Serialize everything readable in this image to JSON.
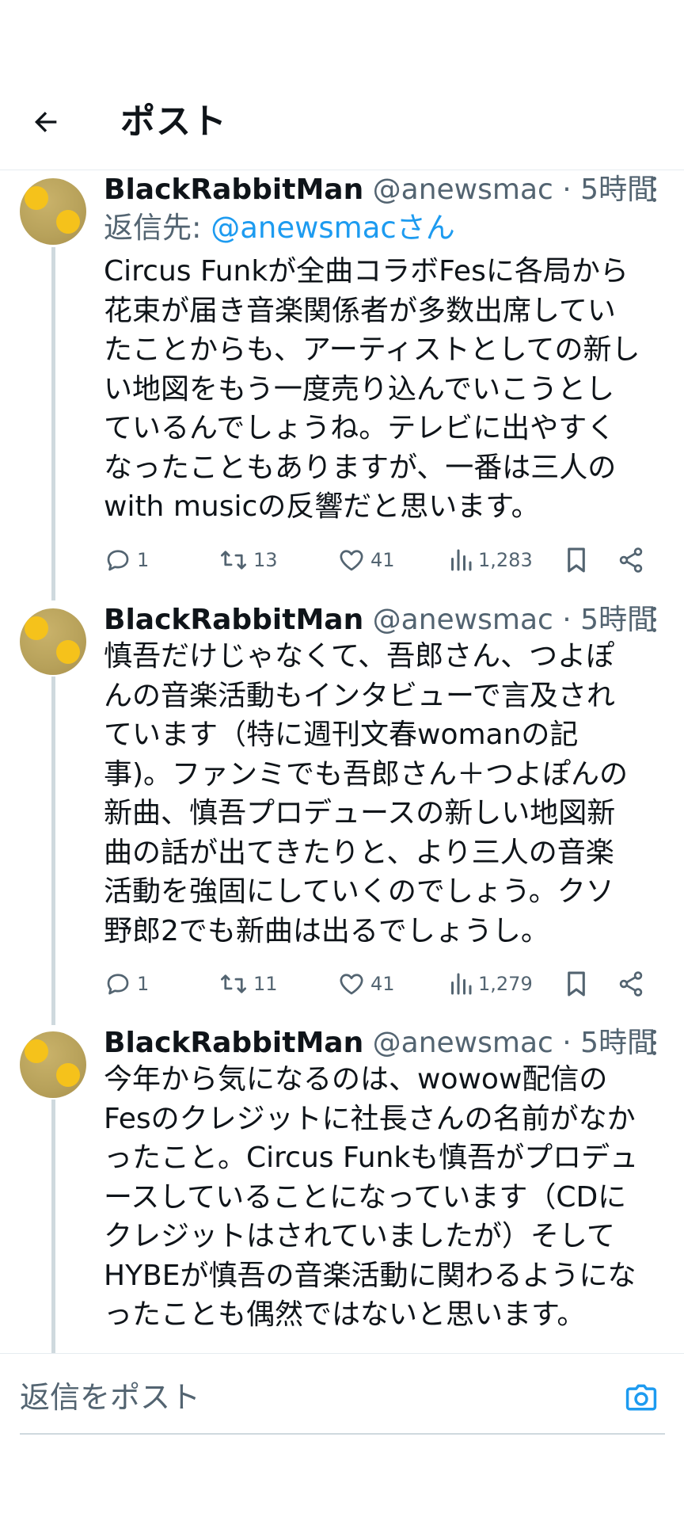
{
  "header": {
    "title": "ポスト"
  },
  "posts": [
    {
      "author": "BlackRabbitMan",
      "handle": "@anewsmac",
      "separator": "·",
      "time": "5時間",
      "reply_label": "返信先:",
      "reply_mention": "@anewsmacさん",
      "text_lines": [
        "Circus Funkが全曲コラボFesに各局から",
        "花束が届き音楽関係者が多数出席してい",
        "たことからも、アーティストとしての新し",
        "い地図をもう一度売り込んでいこうとし",
        "ているんでしょうね。テレビに出やすく",
        "なったこともありますが、一番は三人の",
        "with musicの反響だと思います。"
      ],
      "stats": {
        "replies": "1",
        "reposts": "13",
        "likes": "41",
        "views": "1,283"
      }
    },
    {
      "author": "BlackRabbitMan",
      "handle": "@anewsmac",
      "separator": "·",
      "time": "5時間",
      "text_lines": [
        "慎吾だけじゃなくて、吾郎さん、つよぽ",
        "んの音楽活動もインタビューで言及され",
        "ています（特に週刊文春womanの記",
        "事)。ファンミでも吾郎さん＋つよぽんの",
        "新曲、慎吾プロデュースの新しい地図新",
        "曲の話が出てきたりと、より三人の音楽",
        "活動を強固にしていくのでしょう。クソ",
        "野郎2でも新曲は出るでしょうし。"
      ],
      "stats": {
        "replies": "1",
        "reposts": "11",
        "likes": "41",
        "views": "1,279"
      }
    },
    {
      "author": "BlackRabbitMan",
      "handle": "@anewsmac",
      "separator": "·",
      "time": "5時間",
      "text_lines": [
        "今年から気になるのは、wowow配信の",
        "Fesのクレジットに社長さんの名前がなか",
        "ったこと。Circus Funkも慎吾がプロデュ",
        "ースしていることになっています（CDに",
        "クレジットはされていましたが）そして",
        "HYBEが慎吾の音楽活動に関わるようにな",
        "ったことも偶然ではないと思います。"
      ]
    }
  ],
  "composer": {
    "placeholder": "返信をポスト"
  },
  "colors": {
    "accent": "#1d9bf0",
    "secondary_text": "#536471",
    "thread_line": "#cfd9de"
  },
  "icons": {
    "back": "arrow-left-icon",
    "more": "more-vertical-icon",
    "reply": "comment-icon",
    "repost": "repost-icon",
    "like": "heart-icon",
    "views": "bar-chart-icon",
    "bookmark": "bookmark-icon",
    "share": "share-icon",
    "camera": "camera-icon"
  }
}
